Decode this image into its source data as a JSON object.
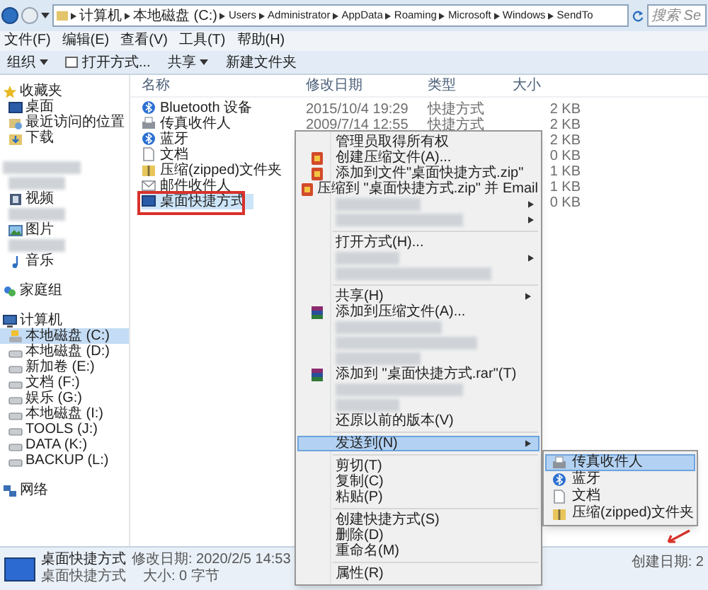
{
  "address_bar": {
    "path": [
      "计算机",
      "本地磁盘 (C:)",
      "Users",
      "Administrator",
      "AppData",
      "Roaming",
      "Microsoft",
      "Windows",
      "SendTo"
    ],
    "search": {
      "placeholder": "搜索 Se"
    }
  },
  "menu_bar": [
    "文件(F)",
    "编辑(E)",
    "查看(V)",
    "工具(T)",
    "帮助(H)"
  ],
  "toolbar": [
    {
      "label": "组织",
      "dropdown": true,
      "kind": "plain"
    },
    {
      "label": "打开方式...",
      "dropdown": false,
      "kind": "open"
    },
    {
      "label": "共享",
      "dropdown": true,
      "kind": "plain"
    },
    {
      "label": "新建文件夹",
      "dropdown": false,
      "kind": "plain"
    }
  ],
  "sidebar": {
    "groups": [
      {
        "items": [
          {
            "kind": "star",
            "label": "收藏夹",
            "selected": false
          },
          {
            "kind": "desktop",
            "label": "桌面",
            "selected": false
          },
          {
            "kind": "recent",
            "label": "最近访问的位置",
            "selected": false
          },
          {
            "kind": "download",
            "label": "下载",
            "selected": false
          }
        ]
      },
      {
        "items": [
          {
            "kind": "blurred"
          },
          {
            "kind": "blurred"
          },
          {
            "kind": "video",
            "label": "视频",
            "selected": false
          },
          {
            "kind": "blurred"
          },
          {
            "kind": "picture",
            "label": "图片",
            "selected": false
          },
          {
            "kind": "blurred"
          },
          {
            "kind": "music",
            "label": "音乐",
            "selected": false
          }
        ]
      },
      {
        "items": [
          {
            "kind": "homegroup",
            "label": "家庭组",
            "selected": false
          }
        ]
      },
      {
        "items": [
          {
            "kind": "computer",
            "label": "计算机",
            "selected": false
          },
          {
            "kind": "sysdrive",
            "label": "本地磁盘 (C:)",
            "selected": true
          },
          {
            "kind": "drive",
            "label": "本地磁盘 (D:)",
            "selected": false
          },
          {
            "kind": "drive",
            "label": "新加卷 (E:)",
            "selected": false
          },
          {
            "kind": "drive",
            "label": "文档 (F:)",
            "selected": false
          },
          {
            "kind": "drive",
            "label": "娱乐 (G:)",
            "selected": false
          },
          {
            "kind": "drive",
            "label": "本地磁盘 (I:)",
            "selected": false
          },
          {
            "kind": "drive",
            "label": "TOOLS (J:)",
            "selected": false
          },
          {
            "kind": "drive",
            "label": "DATA (K:)",
            "selected": false
          },
          {
            "kind": "drive",
            "label": "BACKUP (L:)",
            "selected": false
          }
        ]
      },
      {
        "items": [
          {
            "kind": "network",
            "label": "网络",
            "selected": false
          }
        ]
      }
    ]
  },
  "table": {
    "columns": [
      "名称",
      "修改日期",
      "类型",
      "大小"
    ],
    "rows": [
      {
        "kind": "bluetooth",
        "name": "Bluetooth 设备",
        "date": "2015/10/4 19:29",
        "type": "快捷方式",
        "size": "2 KB",
        "selected": false,
        "marked": false
      },
      {
        "kind": "fax",
        "name": "传真收件人",
        "date": "2009/7/14 12:55",
        "type": "快捷方式",
        "size": "2 KB",
        "selected": false,
        "marked": false
      },
      {
        "kind": "bluetooth",
        "name": "蓝牙",
        "size": "2 KB",
        "selected": false,
        "marked": false
      },
      {
        "kind": "doc",
        "name": "文档",
        "size": "0 KB",
        "selected": false,
        "marked": false
      },
      {
        "kind": "zip",
        "name": "压缩(zipped)文件夹",
        "size": "1 KB",
        "selected": false,
        "marked": false
      },
      {
        "kind": "mail",
        "name": "邮件收件人",
        "size": "1 KB",
        "selected": false,
        "marked": false
      },
      {
        "kind": "desktop",
        "name": "桌面快捷方式",
        "size": "0 KB",
        "selected": true,
        "marked": true
      }
    ]
  },
  "context_menu": [
    {
      "kind": "text",
      "label": "管理员取得所有权",
      "submenu": false,
      "selected": false
    },
    {
      "kind": "zip",
      "label": "创建压缩文件(A)...",
      "submenu": false,
      "selected": false
    },
    {
      "kind": "zip",
      "label": "添加到文件\"桌面快捷方式.zip\"",
      "submenu": false,
      "selected": false
    },
    {
      "kind": "zip",
      "label": "压缩到 \"桌面快捷方式.zip\" 并 Email",
      "submenu": false,
      "selected": false
    },
    {
      "kind": "blurred",
      "submenu": true
    },
    {
      "kind": "blurred",
      "submenu": true
    },
    {
      "kind": "separator"
    },
    {
      "kind": "text",
      "label": "打开方式(H)...",
      "submenu": false,
      "selected": false
    },
    {
      "kind": "blurred",
      "submenu": true
    },
    {
      "kind": "blurred",
      "submenu": false
    },
    {
      "kind": "separator"
    },
    {
      "kind": "text",
      "label": "共享(H)",
      "submenu": true,
      "selected": false
    },
    {
      "kind": "rar",
      "label": "添加到压缩文件(A)...",
      "submenu": false,
      "selected": false
    },
    {
      "kind": "blurred",
      "submenu": false
    },
    {
      "kind": "blurred",
      "submenu": false
    },
    {
      "kind": "blurred",
      "submenu": false
    },
    {
      "kind": "rar",
      "label": "添加到 \"桌面快捷方式.rar\"(T)",
      "submenu": false,
      "selected": false
    },
    {
      "kind": "blurred",
      "submenu": false
    },
    {
      "kind": "blurred",
      "submenu": false
    },
    {
      "kind": "text",
      "label": "还原以前的版本(V)",
      "submenu": false,
      "selected": false
    },
    {
      "kind": "separator"
    },
    {
      "kind": "text",
      "label": "发送到(N)",
      "submenu": true,
      "selected": true
    },
    {
      "kind": "separator"
    },
    {
      "kind": "text",
      "label": "剪切(T)",
      "submenu": false,
      "selected": false
    },
    {
      "kind": "text",
      "label": "复制(C)",
      "submenu": false,
      "selected": false
    },
    {
      "kind": "text",
      "label": "粘贴(P)",
      "submenu": false,
      "selected": false
    },
    {
      "kind": "separator"
    },
    {
      "kind": "text",
      "label": "创建快捷方式(S)",
      "submenu": false,
      "selected": false
    },
    {
      "kind": "text",
      "label": "删除(D)",
      "submenu": false,
      "selected": false
    },
    {
      "kind": "text",
      "label": "重命名(M)",
      "submenu": false,
      "selected": false
    },
    {
      "kind": "separator"
    },
    {
      "kind": "text",
      "label": "属性(R)",
      "submenu": false,
      "selected": false
    }
  ],
  "send_to_menu": [
    {
      "kind": "fax",
      "label": "传真收件人",
      "selected": true
    },
    {
      "kind": "bluetooth",
      "label": "蓝牙",
      "selected": false
    },
    {
      "kind": "doc",
      "label": "文档",
      "selected": false
    },
    {
      "kind": "zip",
      "label": "压缩(zipped)文件夹",
      "selected": false
    }
  ],
  "status_bar": {
    "name": "桌面快捷方式",
    "modified": "修改日期: 2020/2/5 14:53",
    "created": "创建日期: 2",
    "type": "桌面快捷方式",
    "size": "大小: 0 字节"
  }
}
